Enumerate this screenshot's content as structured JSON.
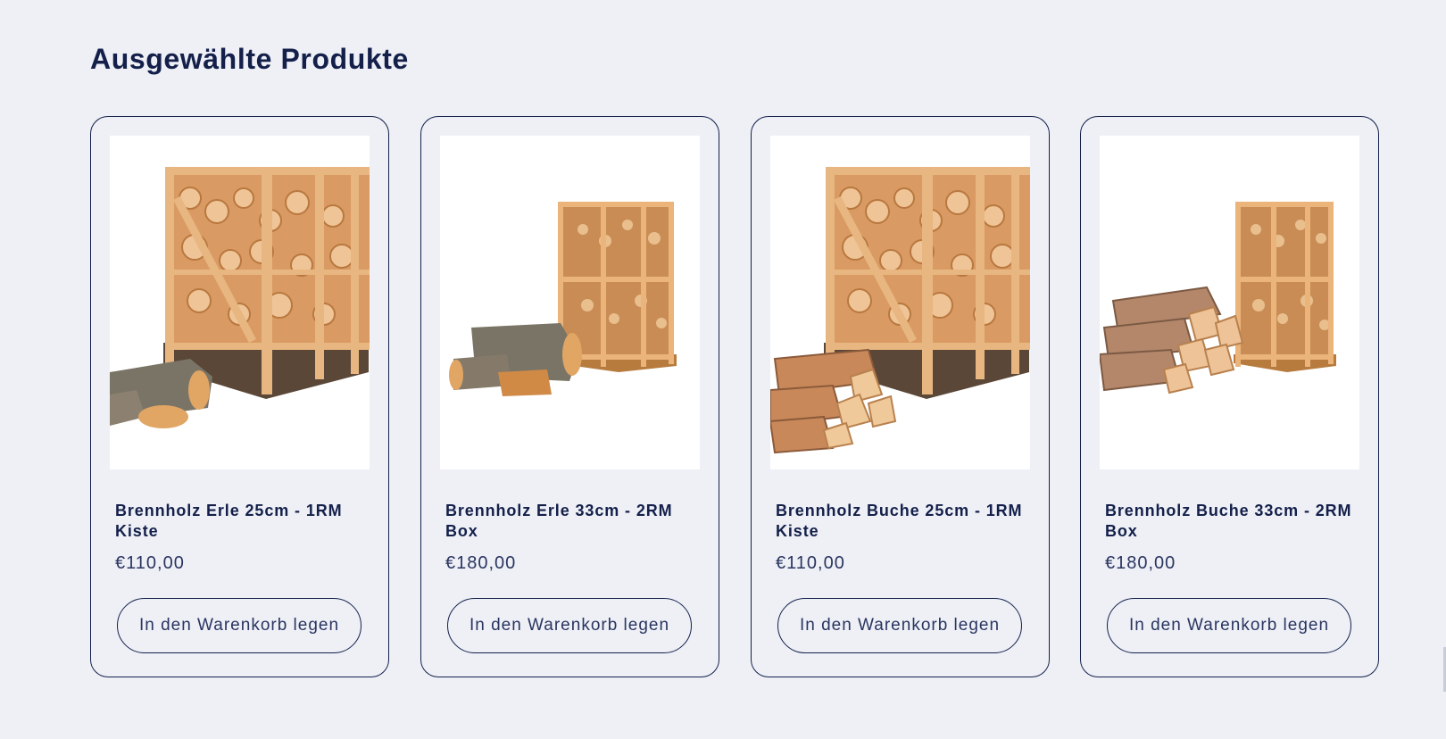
{
  "section": {
    "title": "Ausgewählte Produkte"
  },
  "products": [
    {
      "name": "Brennholz Erle 25cm - 1RM Kiste",
      "price": "€110,00",
      "button": "In den Warenkorb legen",
      "image": "firewood-crate-alder-large"
    },
    {
      "name": "Brennholz Erle 33cm - 2RM Box",
      "price": "€180,00",
      "button": "In den Warenkorb legen",
      "image": "firewood-crate-alder-small"
    },
    {
      "name": "Brennholz Buche 25cm - 1RM Kiste",
      "price": "€110,00",
      "button": "In den Warenkorb legen",
      "image": "firewood-crate-beech-large"
    },
    {
      "name": "Brennholz Buche 33cm - 2RM Box",
      "price": "€180,00",
      "button": "In den Warenkorb legen",
      "image": "firewood-crate-beech-small"
    }
  ],
  "colors": {
    "background": "#eef0f6",
    "text": "#14204a",
    "wood": "#e3a86a"
  }
}
